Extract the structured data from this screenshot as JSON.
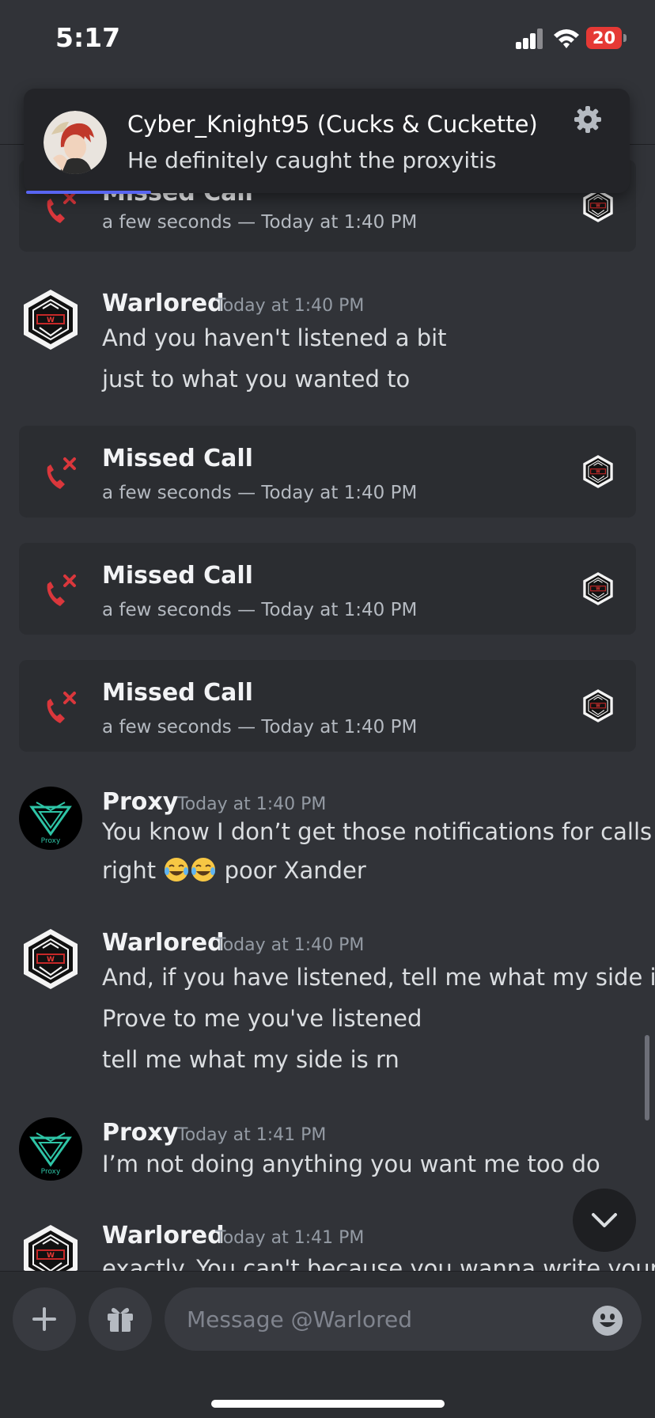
{
  "status_bar": {
    "time": "5:17",
    "battery": "20"
  },
  "notification": {
    "title": "Cyber_Knight95 (Cucks & Cuckette)",
    "body": "He definitely caught the proxyitis",
    "icons": {
      "avatar": "user-avatar",
      "settings": "gear-icon"
    }
  },
  "calls": [
    {
      "title": "Missed Call",
      "subtitle": "a few seconds — Today at 1:40 PM"
    },
    {
      "title": "Missed Call",
      "subtitle": "a few seconds — Today at 1:40 PM"
    },
    {
      "title": "Missed Call",
      "subtitle": "a few seconds — Today at 1:40 PM"
    },
    {
      "title": "Missed Call",
      "subtitle": "a few seconds — Today at 1:40 PM"
    }
  ],
  "messages": [
    {
      "author": "Warlored",
      "time": "Today at 1:40 PM",
      "lines": [
        "And you haven't listened a bit",
        "just to what you wanted to"
      ]
    },
    {
      "author": "Proxy",
      "time": "Today at 1:40 PM",
      "lines": [
        "You know I don’t get those notifications for calls",
        "right",
        "poor Xander"
      ]
    },
    {
      "author": "Warlored",
      "time": "Today at 1:40 PM",
      "lines": [
        "And, if you have listened, tell me what my side is",
        "Prove to me you've listened",
        "tell me what my side is rn"
      ]
    },
    {
      "author": "Proxy",
      "time": "Today at 1:41 PM",
      "lines": [
        "I’m not doing anything you want me too do"
      ]
    },
    {
      "author": "Warlored",
      "time": "Today at 1:41 PM",
      "lines": [
        "exactly. You can't because you wanna write your"
      ]
    }
  ],
  "composer": {
    "placeholder": "Message @Warlored"
  },
  "icons": {
    "missed_call": "missed-call-icon",
    "add": "plus-icon",
    "gift": "gift-icon",
    "emoji": "emoji-icon",
    "jump": "chevron-down-icon"
  },
  "colors": {
    "background": "#313338",
    "card": "#2b2d31",
    "missed_call_red": "#da373c",
    "accent": "#5865f2",
    "battery_red": "#e53935"
  }
}
